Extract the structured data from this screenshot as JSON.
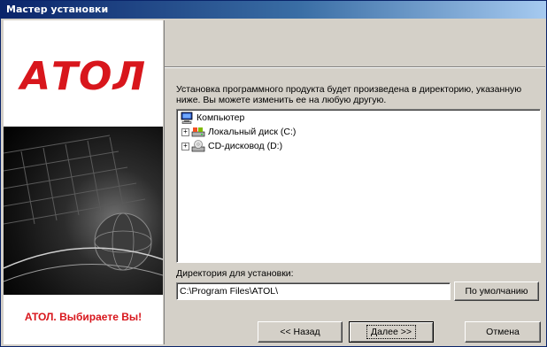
{
  "window": {
    "title": "Мастер установки"
  },
  "branding": {
    "logo": "АТОЛ",
    "tagline": "АТОЛ. Выбираете Вы!",
    "accent_color": "#d8161c"
  },
  "main": {
    "description": "Установка программного продукта будет произведена в директорию, указанную ниже. Вы можете изменить ее на любую другую.",
    "tree": {
      "root": {
        "label": "Компьютер",
        "icon": "computer-icon"
      },
      "children": [
        {
          "label": "Локальный диск (C:)",
          "icon": "hard-drive-icon"
        },
        {
          "label": "CD-дисковод (D:)",
          "icon": "cd-drive-icon"
        }
      ]
    },
    "directory_label": "Директория для установки:",
    "directory_value": "C:\\Program Files\\ATOL\\",
    "default_button": "По умолчанию"
  },
  "buttons": {
    "back": "<< Назад",
    "next": "Далее >>",
    "cancel": "Отмена"
  }
}
